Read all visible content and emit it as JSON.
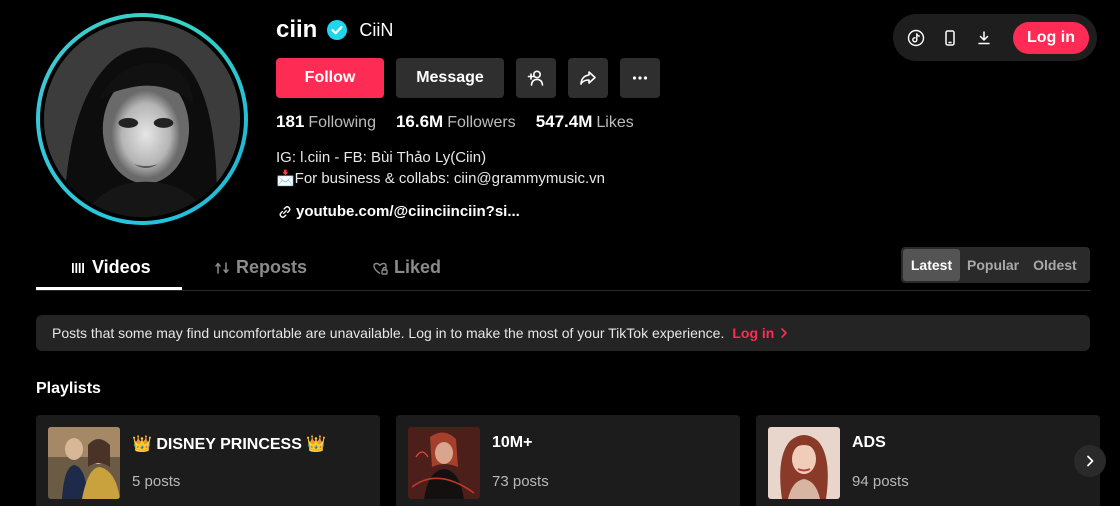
{
  "profile": {
    "username": "ciin",
    "nickname": "CiiN",
    "verified": true,
    "buttons": {
      "follow": "Follow",
      "message": "Message"
    },
    "stats": [
      {
        "value": "181",
        "label": "Following"
      },
      {
        "value": "16.6M",
        "label": "Followers"
      },
      {
        "value": "547.4M",
        "label": "Likes"
      }
    ],
    "bio": {
      "line1": "IG: l.ciin - FB: Bùi Thảo Ly(Ciin)",
      "line2": "📩For business & collabs: ciin@grammymusic.vn"
    },
    "link": "youtube.com/@ciinciinciin?si..."
  },
  "top_bar": {
    "login_label": "Log in"
  },
  "tabs": [
    {
      "label": "Videos",
      "icon": "grid-lines-icon",
      "active": true
    },
    {
      "label": "Reposts",
      "icon": "repost-icon",
      "active": false
    },
    {
      "label": "Liked",
      "icon": "heart-lock-icon",
      "active": false
    }
  ],
  "sort": {
    "options": [
      "Latest",
      "Popular",
      "Oldest"
    ],
    "selected": "Latest"
  },
  "notice": {
    "text": "Posts that some may find uncomfortable are unavailable. Log in to make the most of your TikTok experience.",
    "link": "Log in"
  },
  "playlists": {
    "title": "Playlists",
    "items": [
      {
        "title": "👑 DISNEY PRINCESS 👑",
        "count": "5 posts"
      },
      {
        "title": "10M+",
        "count": "73 posts"
      },
      {
        "title": "ADS",
        "count": "94 posts"
      }
    ]
  },
  "colors": {
    "accent": "#fe2c55",
    "verified": "#20d5ec",
    "background": "#000000"
  }
}
